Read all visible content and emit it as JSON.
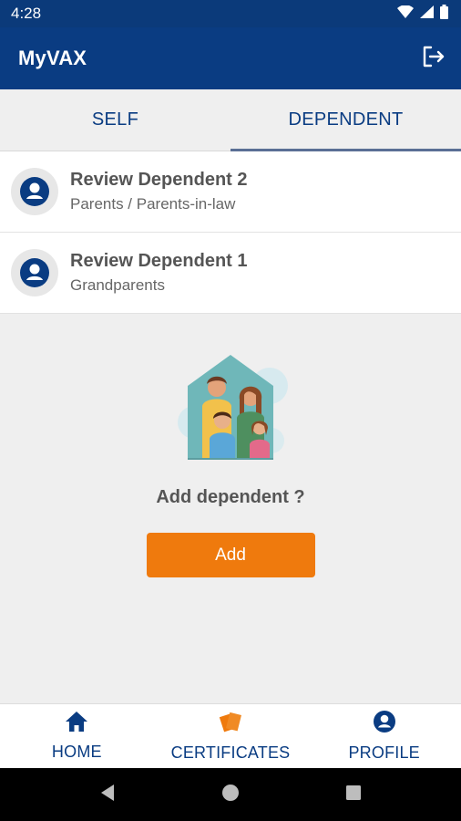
{
  "status_bar": {
    "time": "4:28"
  },
  "app_bar": {
    "title": "MyVAX",
    "logout_icon": "logout-icon"
  },
  "tabs": [
    {
      "label": "SELF",
      "active": false
    },
    {
      "label": "DEPENDENT",
      "active": true
    }
  ],
  "dependents": [
    {
      "name": "Review Dependent 2",
      "relation": "Parents / Parents-in-law",
      "icon": "person-circle-icon"
    },
    {
      "name": "Review Dependent 1",
      "relation": "Grandparents",
      "icon": "person-circle-icon"
    }
  ],
  "empty_state": {
    "prompt": "Add dependent ?",
    "button_label": "Add",
    "illustration": "family-house-illustration"
  },
  "bottom_nav": [
    {
      "label": "HOME",
      "icon": "home-icon"
    },
    {
      "label": "CERTIFICATES",
      "icon": "certificates-icon"
    },
    {
      "label": "PROFILE",
      "icon": "profile-icon"
    }
  ],
  "colors": {
    "primary": "#0a3c82",
    "accent": "#ef7a0d",
    "background": "#efefef"
  }
}
